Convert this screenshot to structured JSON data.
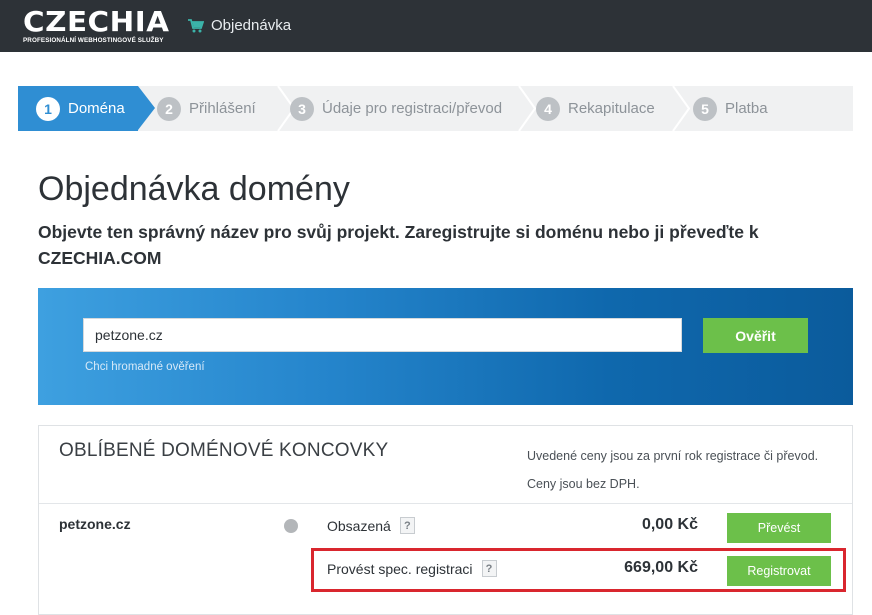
{
  "header": {
    "logo_text": "CZECHIA",
    "logo_tagline": "PROFESIONÁLNÍ WEBHOSTINGOVÉ SLUŽBY",
    "nav_order_label": "Objednávka",
    "nav_order_icon": "cart-icon"
  },
  "steps": [
    {
      "num": "1",
      "label": "Doména",
      "active": true
    },
    {
      "num": "2",
      "label": "Přihlášení",
      "active": false
    },
    {
      "num": "3",
      "label": "Údaje pro registraci/převod",
      "active": false
    },
    {
      "num": "4",
      "label": "Rekapitulace",
      "active": false
    },
    {
      "num": "5",
      "label": "Platba",
      "active": false
    }
  ],
  "page": {
    "title": "Objednávka domény",
    "subtitle": "Objevte ten správný název pro svůj projekt. Zaregistrujte si doménu nebo ji převeďte k CZECHIA.COM"
  },
  "search": {
    "value": "petzone.cz",
    "verify_label": "Ověřit",
    "bulk_link": "Chci hromadné ověření"
  },
  "tld": {
    "title": "OBLÍBENÉ DOMÉNOVÉ KONCOVKY",
    "note_line1": "Uvedené ceny jsou za první rok registrace či převod.",
    "note_line2": "Ceny jsou bez DPH.",
    "domain": "petzone.cz",
    "rows": [
      {
        "label": "Obsazená",
        "help": "?",
        "price": "0,00 Kč",
        "button": "Převést"
      },
      {
        "label": "Provést spec. registraci",
        "help": "?",
        "price": "669,00 Kč",
        "button": "Registrovat"
      }
    ]
  },
  "colors": {
    "topbar": "#2d3237",
    "accent_blue": "#2f8ed3",
    "green": "#6cc04a",
    "highlight_red": "#d9262e"
  }
}
